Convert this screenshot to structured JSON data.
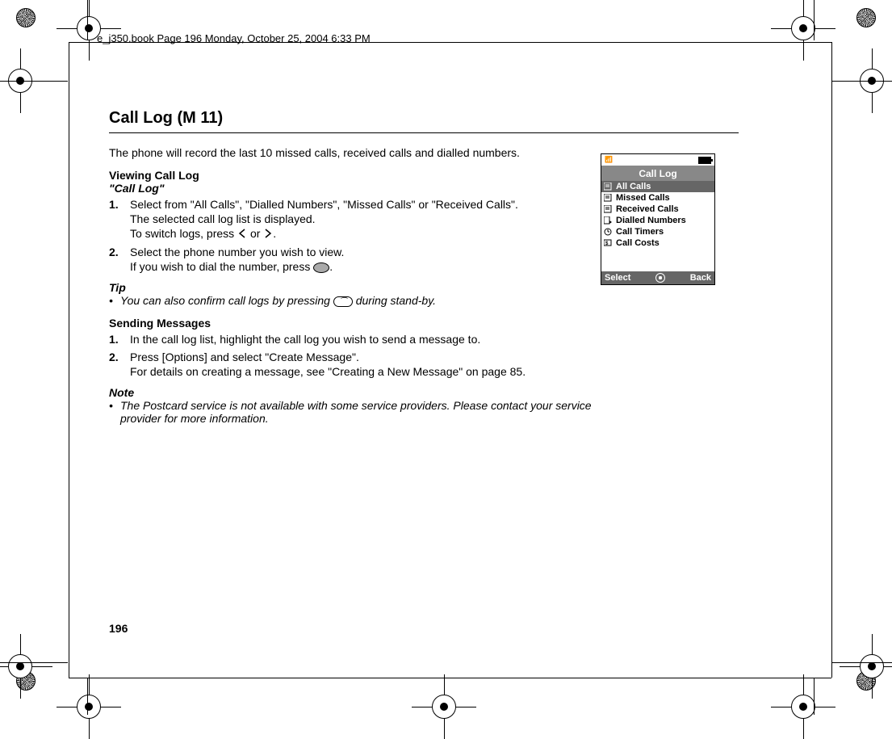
{
  "meta": {
    "header_line": "e_j350.book  Page 196  Monday, October 25, 2004  6:33 PM"
  },
  "page": {
    "title": "Call Log (M 11)",
    "intro": "The phone will record the last 10 missed calls, received calls and dialled numbers.",
    "viewing_heading": "Viewing Call Log",
    "viewing_subheading": "\"Call Log\"",
    "step1_main": "Select from \"All Calls\", \"Dialled Numbers\", \"Missed Calls\" or \"Received Calls\".",
    "step1_sub1": "The selected call log list is displayed.",
    "step1_sub2_a": "To switch logs, press ",
    "step1_sub2_b": " or ",
    "step1_sub2_c": ".",
    "step2_main": "Select the phone number you wish to view.",
    "step2_sub_a": "If you wish to dial the number, press ",
    "step2_sub_b": ".",
    "tip_label": "Tip",
    "tip_text_a": "You can also confirm call logs by pressing ",
    "tip_text_b": " during stand-by.",
    "sending_heading": "Sending Messages",
    "send_step1": "In the call log list, highlight the call log you wish to send a message to.",
    "send_step2_main": "Press [Options] and select \"Create Message\".",
    "send_step2_sub": "For details on creating a message, see \"Creating a New Message\" on page 85.",
    "note_label": "Note",
    "note_text": "The Postcard service is not available with some service providers. Please contact your service provider for more information.",
    "page_number": "196"
  },
  "phone": {
    "title": "Call Log",
    "items": [
      "All Calls",
      "Missed Calls",
      "Received Calls",
      "Dialled Numbers",
      "Call Timers",
      "Call Costs"
    ],
    "softkey_left": "Select",
    "softkey_right": "Back"
  }
}
